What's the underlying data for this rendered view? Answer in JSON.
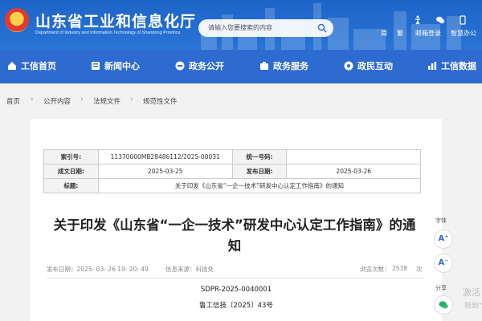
{
  "header": {
    "title": "山东省工业和信息化厅",
    "subtitle": "Department of Industry and Information Technology of Shandong Province",
    "search_placeholder": "请输入您要搜索的内容",
    "links": [
      "简",
      "繁",
      "邮箱登录",
      "智慧办公"
    ]
  },
  "nav": [
    {
      "label": "工信首页",
      "icon": "home-icon"
    },
    {
      "label": "新闻中心",
      "icon": "news-icon"
    },
    {
      "label": "政务公开",
      "icon": "open-icon"
    },
    {
      "label": "政务服务",
      "icon": "service-icon"
    },
    {
      "label": "政民互动",
      "icon": "interaction-icon"
    },
    {
      "label": "工信数据",
      "icon": "data-icon"
    }
  ],
  "breadcrumb": [
    "首页",
    "公开内容",
    "法规文件",
    "规范性文件"
  ],
  "meta": {
    "index_label": "索引号:",
    "index_value": "11370000MB28486112/2025-00031",
    "number_label": "统一号码:",
    "number_value": "",
    "created_label": "成文日期:",
    "created_value": "2025-03-25",
    "published_label": "发布日期:",
    "published_value": "2025-03-26",
    "title_label": "标题:",
    "title_value": "关于印发《山东省“一企一技术”研发中心认定工作指南》的通知"
  },
  "article": {
    "title": "关于印发《山东省“一企一技术”研发中心认定工作指南》的通知",
    "published": "发布日期：2025- 03- 26 19: 20: 49",
    "source": "信息来源：科技处",
    "views_label": "浏览次数：",
    "views": "2538",
    "views_unit": "次",
    "doc_code": "SDPR-2025-0040001",
    "doc_no": "鲁工信技〔2025〕43号"
  },
  "side": {
    "font_label": "字体",
    "font_up": "A⁺",
    "font_down": "A⁻",
    "share_label": "分享"
  },
  "watermark": {
    "line1": "激活",
    "line2": "转到“"
  }
}
